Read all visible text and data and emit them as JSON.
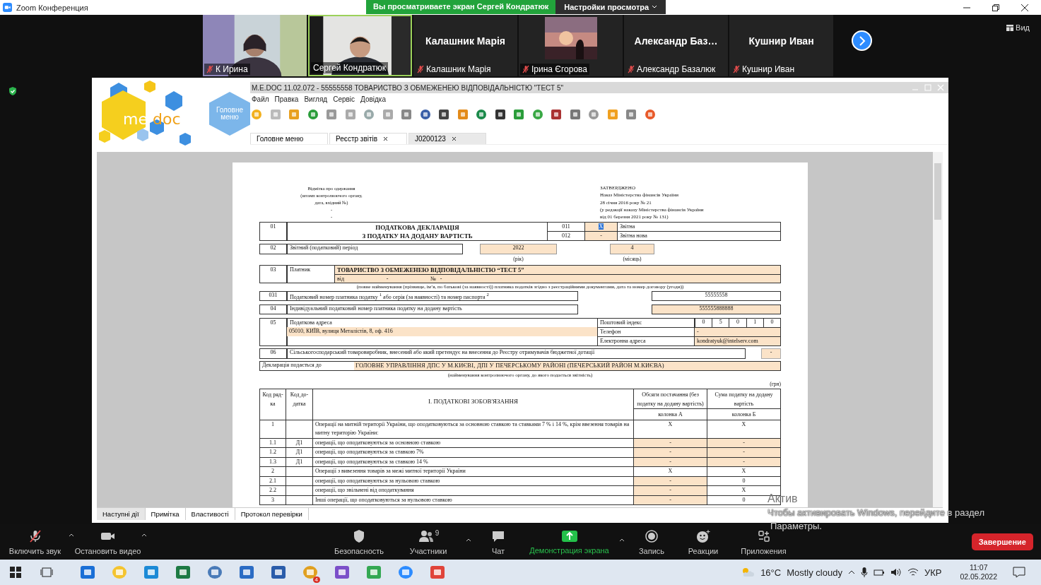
{
  "window": {
    "title": "Zoom Конференция"
  },
  "share_banner": {
    "text": "Вы просматриваете экран Сергей Кондратюк",
    "view_options": "Настройки просмотра"
  },
  "view_button": "Вид",
  "participants": [
    {
      "kind": "video",
      "name": "К Ирина",
      "muted": true,
      "speaking": false
    },
    {
      "kind": "video",
      "name": "Сергей Кондратюк",
      "muted": false,
      "speaking": true
    },
    {
      "kind": "name",
      "title": "Калашник Марія",
      "name": "Калашник Марія",
      "muted": true,
      "speaking": false
    },
    {
      "kind": "avatar",
      "name": "Ірина Єгорова",
      "muted": true,
      "speaking": false
    },
    {
      "kind": "name",
      "title": "Александр  Баз…",
      "name": "Александр Базалюк",
      "muted": true,
      "speaking": false
    },
    {
      "kind": "name",
      "title": "Кушнир Иван",
      "name": "Кушнир Иван",
      "muted": true,
      "speaking": false
    }
  ],
  "medoc": {
    "title": "M.E.DOC 11.02.072  - 55555558 ТОВАРИСТВО З ОБМЕЖЕНЕЮ ВІДПОВІДАЛЬНІСТЮ \"ТЕСТ 5\"",
    "logo": [
      "me",
      "doc"
    ],
    "home_button": "Головне меню",
    "menu": [
      "Файл",
      "Правка",
      "Вигляд",
      "Сервіс",
      "Довідка"
    ],
    "tabs": [
      {
        "label": "Головне меню",
        "selected": false,
        "closable": false
      },
      {
        "label": "Реєстр звітів",
        "selected": false,
        "closable": true
      },
      {
        "label": "J0200123",
        "selected": true,
        "closable": true
      }
    ],
    "bottom_tabs": [
      {
        "label": "Наступні дії",
        "selected": true
      },
      {
        "label": "Примітка",
        "selected": false
      },
      {
        "label": "Властивості",
        "selected": false
      },
      {
        "label": "Протокол перевірки",
        "selected": false
      }
    ],
    "doc": {
      "receipt_note": [
        "Відмітка про одержання",
        "(штамп контролюючого органу,",
        "дата, вхідний №)",
        "-",
        "-"
      ],
      "approval": [
        "ЗАТВЕРДЖЕНО",
        "Наказ Міністерства фінансів України",
        "28 січня 2016 року № 21",
        "(у редакції наказу Міністерства фінансів України",
        "від 01 березня 2021 року № 131)"
      ],
      "declaration": {
        "code": "01",
        "title": [
          "ПОДАТКОВА ДЕКЛАРАЦІЯ",
          "З ПОДАТКУ НА ДОДАНУ ВАРТІСТЬ"
        ],
        "types": [
          {
            "code": "011",
            "value": "X",
            "label": "Звітна",
            "selected": true
          },
          {
            "code": "012",
            "value": "-",
            "label": "Звітна нова",
            "selected": false
          }
        ]
      },
      "period": {
        "code": "02",
        "label": "Звітний (податковий) період",
        "year": "2022",
        "year_caption": "(рік)",
        "month": "4",
        "month_caption": "(місяць)"
      },
      "payer": {
        "code": "03",
        "label": "Платник",
        "name": "ТОВАРИСТВО З ОБМЕЖЕНЕЮ ВІДПОВІДАЛЬНІСТЮ “ТЕСТ 5”",
        "date_label": "від",
        "date": "-",
        "number_label": "№",
        "number": "-",
        "caption": "(повне найменування (прізвище, ім’я, по батькові (за наявності)) платника податків згідно з реєстраційними документами, дата та номер договору (угоди))"
      },
      "tax_number": {
        "code": "031",
        "label": "Податковий номер платника податку $^{1}$ або серія (за наявності) та номер паспорта $^{2}$",
        "value": "55555558"
      },
      "vat_number": {
        "code": "04",
        "label": "Індивідуальний податковий номер платника податку на додану вартість",
        "value": "555555888888"
      },
      "address": {
        "code": "05",
        "label": "Податкова адреса",
        "value": "05010, КИЇВ, вулиця Металістів, 8, оф. 416",
        "postal_label": "Поштовий індекс",
        "postal_digits": [
          "0",
          "5",
          "0",
          "1",
          "0"
        ],
        "phone_label": "Телефон",
        "phone": "-",
        "email_label": "Електронна адреса",
        "email": "kondratyuk@intelserv.com"
      },
      "agri": {
        "code": "06",
        "label": "Сільськогосподарський товаровиробник, внесений або який претендує на внесення до Реєстру отримувачів бюджетної дотації",
        "value": "-"
      },
      "authority": {
        "label": "Декларація подається до",
        "value": "ГОЛОВНЕ УПРАВЛІННЯ ДПС У М.КИЄВІ, ДПІ У ПЕЧЕРСЬКОМУ РАЙОНІ (ПЕЧЕРСЬКИЙ РАЙОН М.КИЄВА)",
        "caption": "(найменування контролюючого органу, до якого подається звітність)"
      },
      "currency": "(грн)",
      "table": {
        "columns": {
          "row_code": "Код ряд-ка",
          "appendix": "Код до-датка",
          "section": "І. ПОДАТКОВІ ЗОБОВ'ЯЗАННЯ",
          "a": "Обсяги постачання (без податку на додану вартість)",
          "a_sub": "колонка А",
          "b": "Сума податку на додану вартість",
          "b_sub": "колонка Б"
        },
        "rows": [
          {
            "code": "1",
            "text": "Операції на митній території України, що оподатковуються за основною ставкою та ставками 7 % і 14 %, крім ввезення товарів на митну територію України:",
            "a": {
              "value": "X",
              "editable": false
            },
            "b": {
              "value": "X",
              "editable": false
            }
          },
          {
            "code": "1.1",
            "appendix": "Д1",
            "text": "операції, що оподатковуються за основною ставкою",
            "a": {
              "value": "-",
              "editable": true
            },
            "b": {
              "value": "-",
              "editable": true
            }
          },
          {
            "code": "1.2",
            "appendix": "Д1",
            "text": "операції, що оподатковуються за ставкою 7%",
            "a": {
              "value": "-",
              "editable": true
            },
            "b": {
              "value": "-",
              "editable": true
            }
          },
          {
            "code": "1.3",
            "appendix": "Д1",
            "text": "операції, що оподатковуються за ставкою 14 %",
            "a": {
              "value": "-",
              "editable": true
            },
            "b": {
              "value": "-",
              "editable": true
            }
          },
          {
            "code": "2",
            "text": "Операції з вивезення товарів за межі митної території України",
            "a": {
              "value": "X",
              "editable": false
            },
            "b": {
              "value": "X",
              "editable": false
            }
          },
          {
            "code": "2.1",
            "text": "операції, що оподатковуються за нульовою ставкою",
            "a": {
              "value": "-",
              "editable": true
            },
            "b": {
              "value": "0",
              "editable": false
            }
          },
          {
            "code": "2.2",
            "text": "операції, що звільнені від оподаткування",
            "a": {
              "value": "-",
              "editable": true
            },
            "b": {
              "value": "X",
              "editable": false
            }
          },
          {
            "code": "3",
            "text": "Інші операції, що оподатковуються за нульовою ставкою",
            "a": {
              "value": "-",
              "editable": true
            },
            "b": {
              "value": "0",
              "editable": false
            }
          }
        ]
      }
    }
  },
  "toolbar": {
    "audio": "Включить звук",
    "video": "Остановить видео",
    "security": "Безопасность",
    "participants": "Участники",
    "participants_count": "9",
    "chat": "Чат",
    "share": "Демонстрация экрана",
    "record": "Запись",
    "reactions": "Реакции",
    "apps": "Приложения",
    "end": "Завершение"
  },
  "windows_notice": {
    "title": "Актив",
    "lines": [
      "Чтобы активировать Windows, перейдите в раздел",
      "Параметры."
    ]
  },
  "taskbar": {
    "badge": "4",
    "temperature": "16°C",
    "weather": "Mostly cloudy",
    "language": "УКР",
    "time": "11:07",
    "date": "02.05.2022"
  }
}
